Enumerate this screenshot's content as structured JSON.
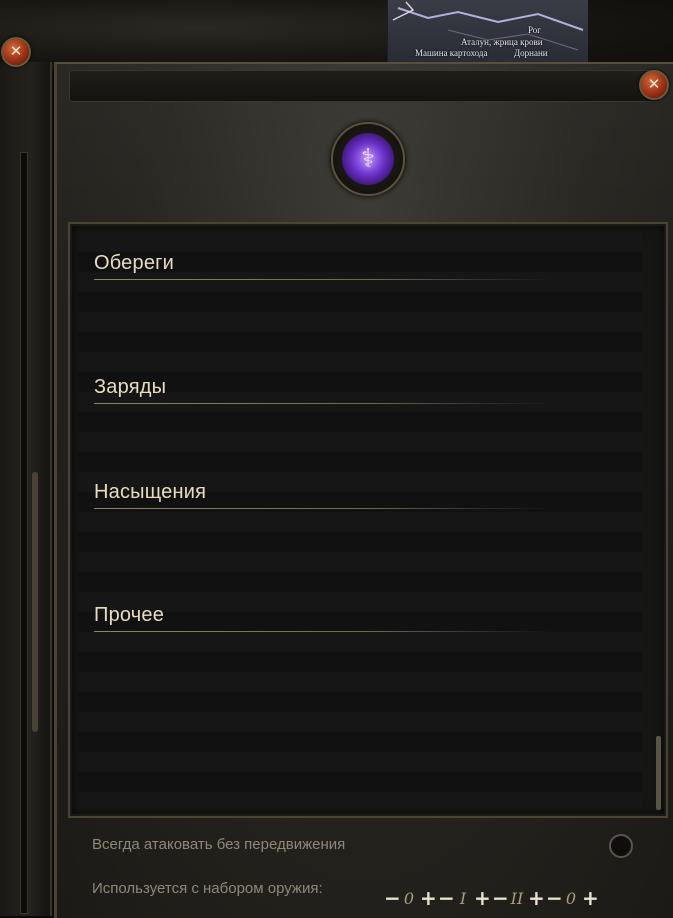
{
  "map": {
    "labels": [
      {
        "text": "Рог"
      },
      {
        "text": "Аталун, жрица крови"
      },
      {
        "text": "Машина картохода"
      },
      {
        "text": "Дорнани"
      }
    ]
  },
  "panel": {
    "emblem_glyph": "⚕",
    "sections": [
      {
        "title": "Обереги"
      },
      {
        "title": "Заряды"
      },
      {
        "title": "Насыщения"
      },
      {
        "title": "Прочее"
      }
    ]
  },
  "options": {
    "always_attack_label": "Всегда атаковать без передвижения",
    "weapon_set_label": "Используется с набором оружия:",
    "weapon_sets": [
      {
        "minus": "−",
        "num": "0",
        "plus": "+"
      },
      {
        "minus": "−",
        "num": "I",
        "plus": "+"
      },
      {
        "minus": "−",
        "num": "II",
        "plus": "+"
      },
      {
        "minus": "−",
        "num": "0",
        "plus": "+"
      }
    ]
  },
  "colors": {
    "accent_purple": "#7b3ad6",
    "close_red": "#9a2f14",
    "heading_text": "#e7dcc2"
  }
}
